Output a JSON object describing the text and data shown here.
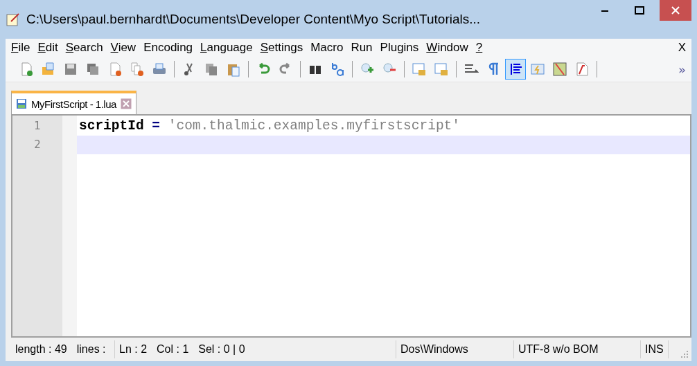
{
  "window": {
    "title": "C:\\Users\\paul.bernhardt\\Documents\\Developer Content\\Myo Script\\Tutorials..."
  },
  "menu": [
    {
      "label": "File",
      "underlined": true
    },
    {
      "label": "Edit",
      "underlined": true
    },
    {
      "label": "Search",
      "underlined": true
    },
    {
      "label": "View",
      "underlined": true
    },
    {
      "label": "Encoding",
      "underlined": false
    },
    {
      "label": "Language",
      "underlined": true
    },
    {
      "label": "Settings",
      "underlined": true
    },
    {
      "label": "Macro",
      "underlined": false
    },
    {
      "label": "Run",
      "underlined": false
    },
    {
      "label": "Plugins",
      "underlined": false
    },
    {
      "label": "Window",
      "underlined": true
    },
    {
      "label": "?",
      "underlined": true
    }
  ],
  "menu_close": "X",
  "toolbar": {
    "groups": [
      [
        {
          "pressed": false
        },
        {
          "pressed": false
        },
        {
          "pressed": false
        },
        {
          "pressed": false
        },
        {
          "pressed": false
        },
        {
          "pressed": false
        },
        {
          "pressed": false
        }
      ],
      [
        {
          "pressed": false
        },
        {
          "pressed": false
        },
        {
          "pressed": false
        }
      ],
      [
        {
          "pressed": false
        },
        {
          "pressed": false
        }
      ],
      [
        {
          "pressed": false
        },
        {
          "pressed": false
        }
      ],
      [
        {
          "pressed": false
        },
        {
          "pressed": false
        }
      ],
      [
        {
          "pressed": false
        },
        {
          "pressed": false
        }
      ],
      [
        {
          "pressed": false
        },
        {
          "pressed": false
        },
        {
          "pressed": true
        },
        {
          "pressed": false
        },
        {
          "pressed": false
        },
        {
          "pressed": false
        }
      ]
    ],
    "overflow": "»"
  },
  "tabs": [
    {
      "label": "MyFirstScript - 1.lua",
      "selected": true
    }
  ],
  "editor": {
    "lines": [
      {
        "number": "1",
        "current": false,
        "tokens": [
          {
            "kind": "identifier",
            "text": "scriptId"
          },
          {
            "kind": "operator",
            "text": " = "
          },
          {
            "kind": "string",
            "text": "'com.thalmic.examples.myfirstscript'"
          }
        ]
      },
      {
        "number": "2",
        "current": true
      }
    ]
  },
  "status_bar": {
    "segments": [
      {
        "texts": [
          "length : 49",
          "lines :"
        ]
      },
      {
        "texts": [
          "Ln : 2",
          "Col : 1",
          "Sel : 0 | 0"
        ]
      },
      {
        "texts": [
          "Dos\\Windows"
        ]
      },
      {
        "texts": [
          "UTF-8 w/o BOM"
        ]
      },
      {
        "texts": [
          "INS"
        ]
      }
    ]
  }
}
